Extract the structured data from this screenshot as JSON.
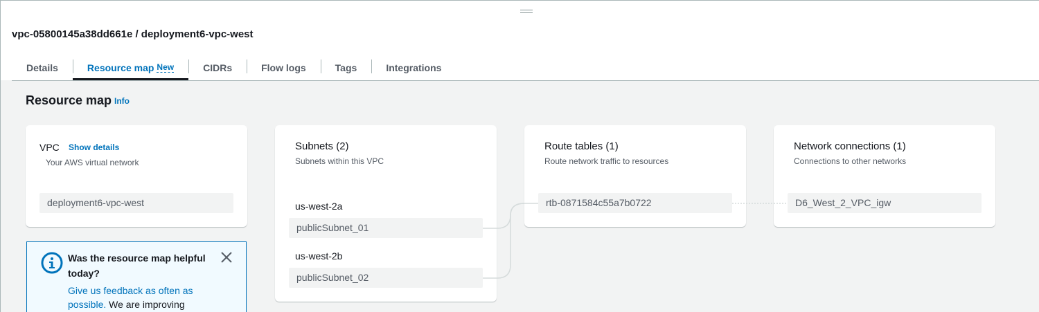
{
  "header": {
    "title": "vpc-05800145a38dd661e / deployment6-vpc-west"
  },
  "tabs": [
    {
      "label": "Details"
    },
    {
      "label": "Resource map",
      "badge": "New"
    },
    {
      "label": "CIDRs"
    },
    {
      "label": "Flow logs"
    },
    {
      "label": "Tags"
    },
    {
      "label": "Integrations"
    }
  ],
  "active_tab": "Resource map",
  "resource_map": {
    "title": "Resource map",
    "info_link": "Info",
    "vpc_card": {
      "title": "VPC",
      "show_details": "Show details",
      "subtitle": "Your AWS virtual network",
      "item": "deployment6-vpc-west"
    },
    "subnets_card": {
      "title": "Subnets (2)",
      "subtitle": "Subnets within this VPC",
      "groups": [
        {
          "az": "us-west-2a",
          "subnet": "publicSubnet_01"
        },
        {
          "az": "us-west-2b",
          "subnet": "publicSubnet_02"
        }
      ]
    },
    "route_tables_card": {
      "title": "Route tables (1)",
      "subtitle": "Route network traffic to resources",
      "item": "rtb-0871584c55a7b0722"
    },
    "network_card": {
      "title": "Network connections (1)",
      "subtitle": "Connections to other networks",
      "item": "D6_West_2_VPC_igw"
    }
  },
  "feedback": {
    "title": "Was the resource map helpful today?",
    "link_text": "Give us feedback as often as possible.",
    "body_text": " We are improving"
  },
  "colors": {
    "link": "#0073bb",
    "background": "#f2f3f3",
    "card": "#ffffff",
    "connector": "#d5dbdb",
    "feedback_bg": "#f1faff"
  },
  "icons": {
    "feedback_icon": "info-circle-icon",
    "close_icon": "close-icon"
  }
}
